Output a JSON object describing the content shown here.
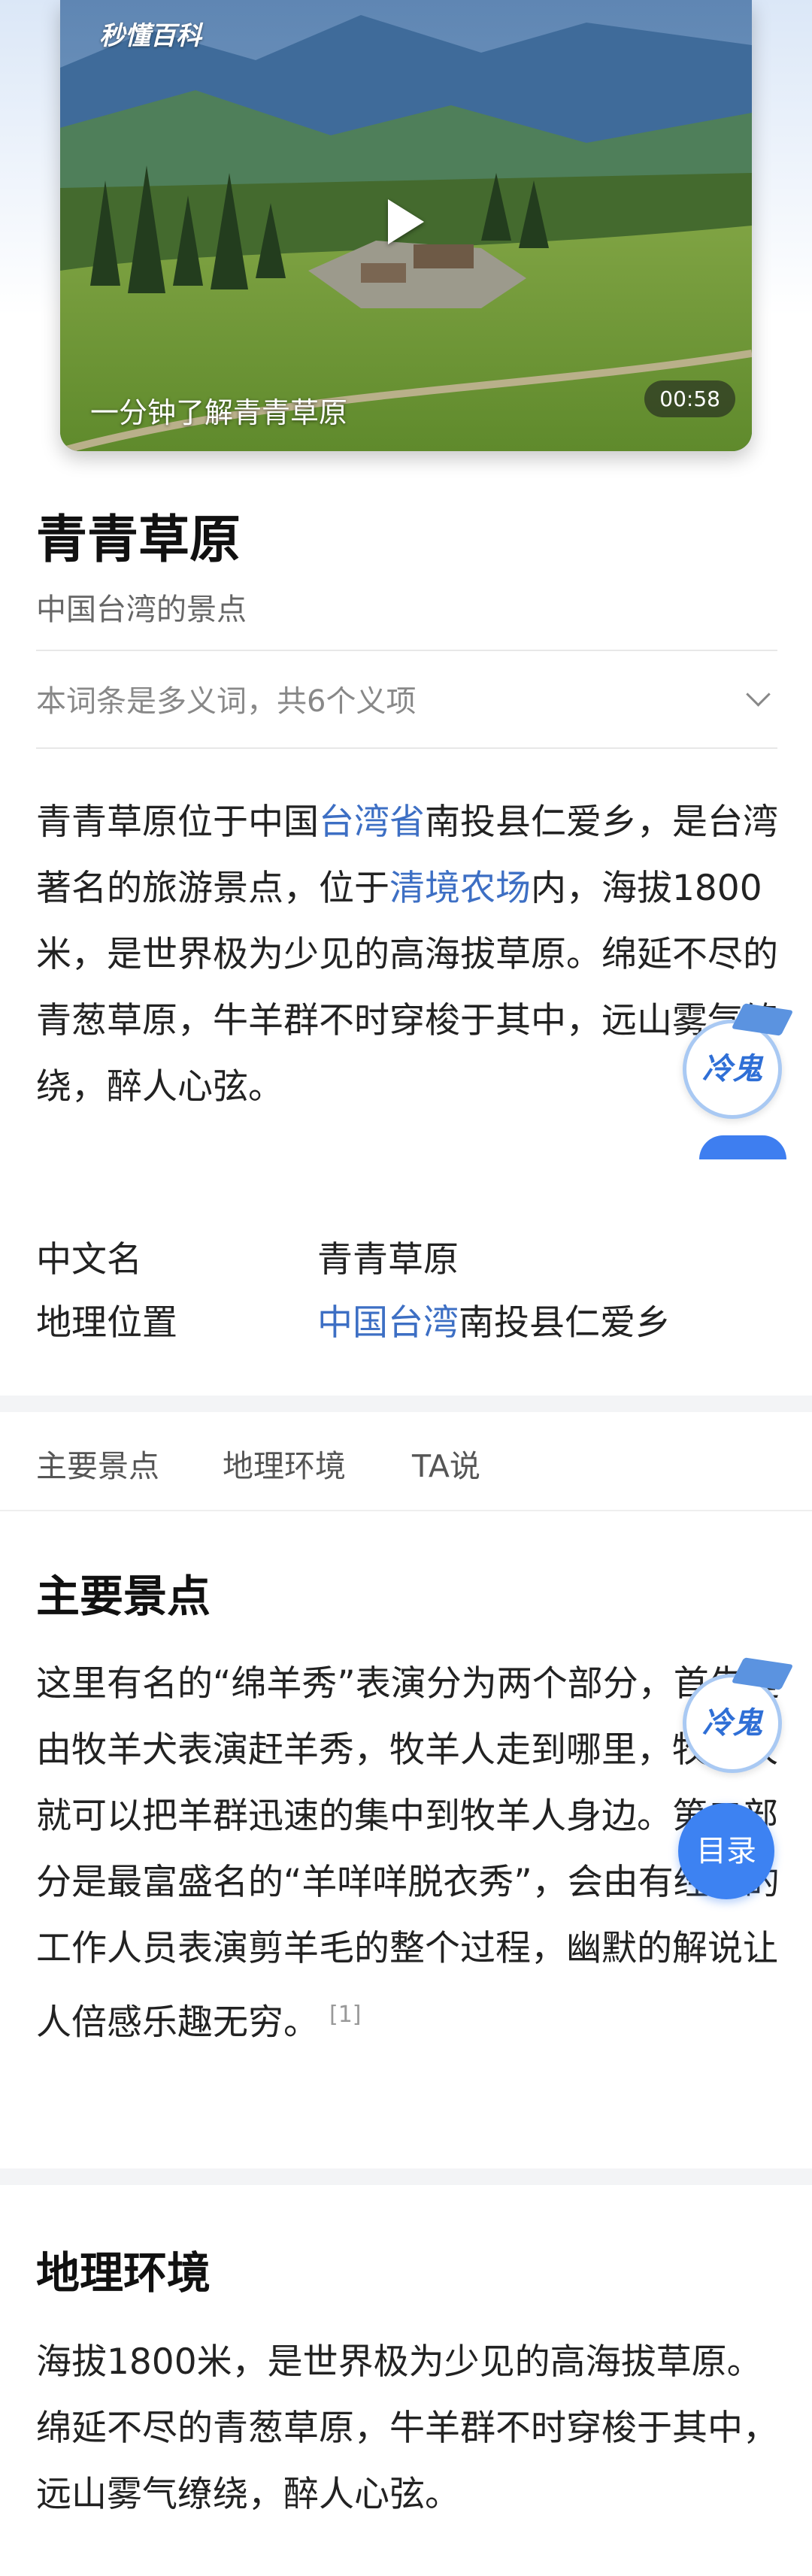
{
  "video": {
    "brand": "秒懂百科",
    "caption": "一分钟了解青青草原",
    "duration": "00:58"
  },
  "entry": {
    "title": "青青草原",
    "subtitle": "中国台湾的景点",
    "polysemy": "本词条是多义词，共6个义项"
  },
  "intro": {
    "p1": "青青草原位于中国",
    "link1": "台湾省",
    "p2": "南投县仁爱乡，是台湾著名的旅游景点，位于",
    "link2": "清境农场",
    "p3": "内，海拔1800米，是世界极为少见的高海拔草原。绵延不尽的青葱草原，牛羊群不时穿梭于其中，远山雾气缭绕，醉人心弦。"
  },
  "basic_info": {
    "name_key": "中文名",
    "name_val": "青青草原",
    "loc_key": "地理位置",
    "loc_link": "中国台湾",
    "loc_rest": "南投县仁爱乡"
  },
  "tabs": [
    "主要景点",
    "地理环境",
    "TA说"
  ],
  "sections": {
    "main": {
      "title": "主要景点",
      "text": "这里有名的“绵羊秀”表演分为两个部分，首先是由牧羊犬表演赶羊秀，牧羊人走到哪里，牧羊犬就可以把羊群迅速的集中到牧羊人身边。第二部分是最富盛名的“羊咩咩脱衣秀”，会由有经验的工作人员表演剪羊毛的整个过程，幽默的解说让人倍感乐趣无穷。",
      "cite": "[1]"
    },
    "geo": {
      "title": "地理环境",
      "text": "海拔1800米，是世界极为少见的高海拔草原。绵延不尽的青葱草原，牛羊群不时穿梭于其中，远山雾气缭绕，醉人心弦。"
    }
  },
  "widgets": {
    "mascot_label": "冷鬼",
    "toc": "目录"
  },
  "colors": {
    "link": "#3d6fc4",
    "accent": "#3d82f2"
  }
}
